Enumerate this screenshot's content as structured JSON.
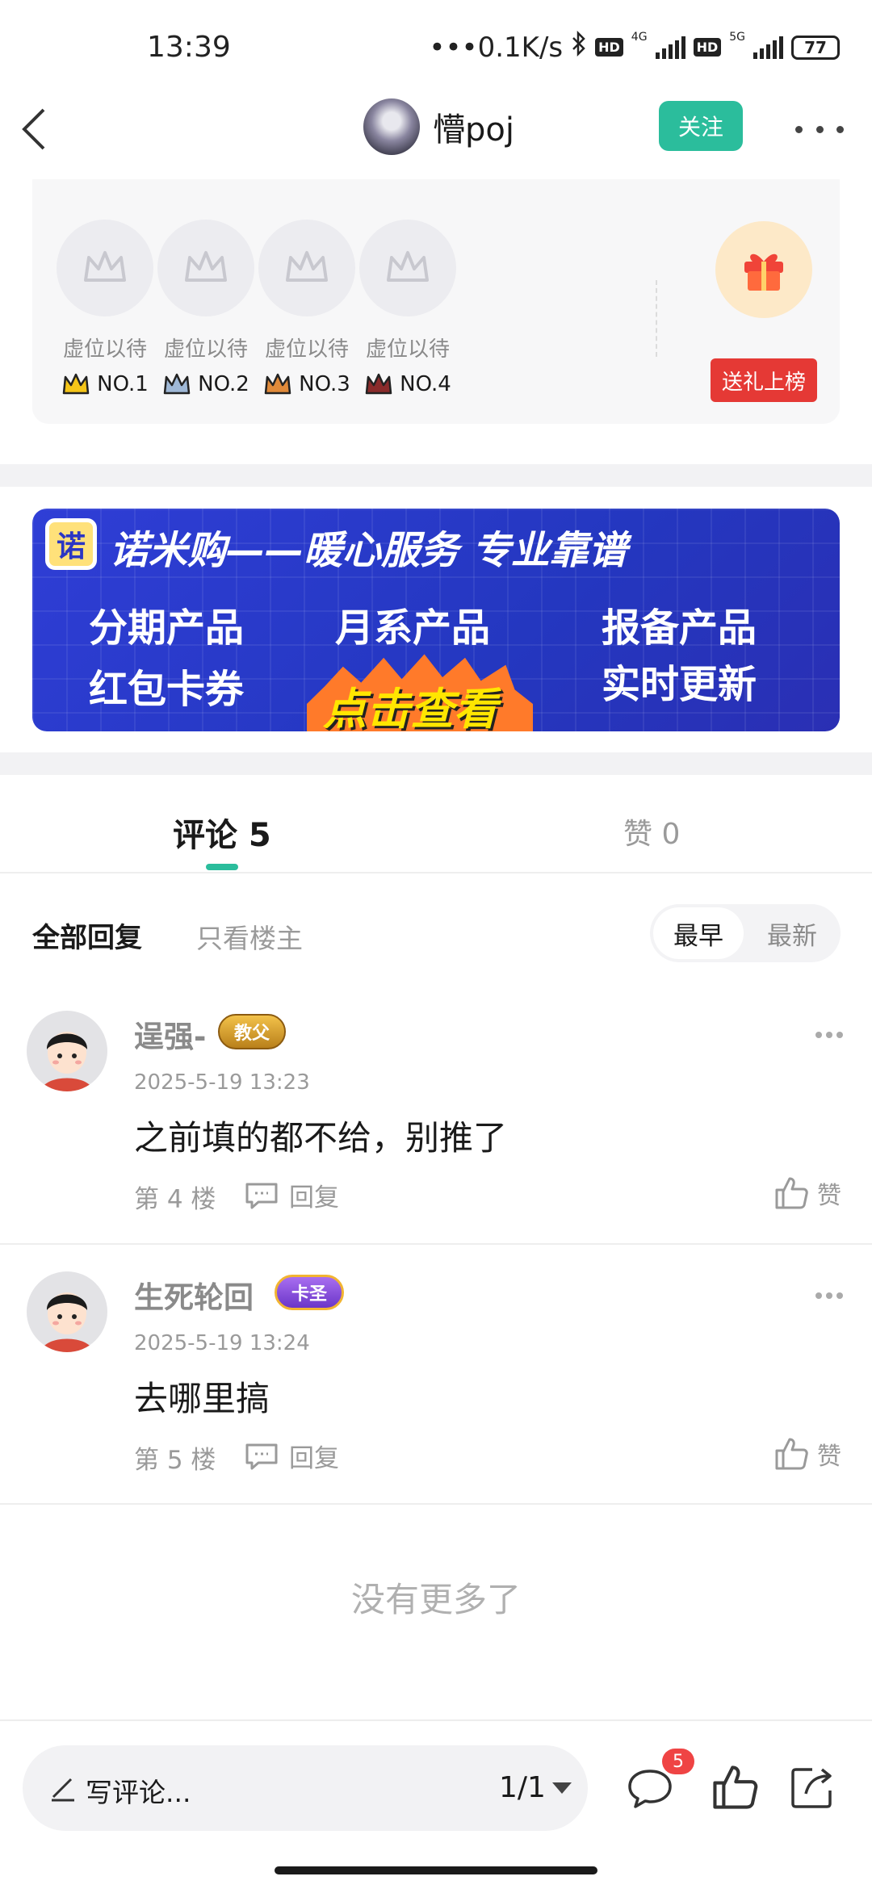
{
  "status_bar": {
    "time": "13:39",
    "speed": "•••0.1K/s",
    "hd": "HD",
    "net1": "4G",
    "net2": "5G",
    "battery": "77"
  },
  "nav": {
    "username": "懵poj",
    "follow_label": "关注"
  },
  "rank": {
    "slots": [
      {
        "label": "虚位以待",
        "rank": "NO.1",
        "crown_color": "#f5c518"
      },
      {
        "label": "虚位以待",
        "rank": "NO.2",
        "crown_color": "#9fb8d6"
      },
      {
        "label": "虚位以待",
        "rank": "NO.3",
        "crown_color": "#e08a3a"
      },
      {
        "label": "虚位以待",
        "rank": "NO.4",
        "crown_color": "#8a2b2b"
      }
    ],
    "send_gift_label": "送礼上榜"
  },
  "banner": {
    "logo": "诺",
    "headline": "诺米购——暖心服务 专业靠谱",
    "items": [
      "分期产品",
      "月系产品",
      "报备产品",
      "红包卡券",
      "实时更新"
    ],
    "cta": "点击查看"
  },
  "tabs": {
    "comments_label": "评论 5",
    "likes_label": "赞 0"
  },
  "filters": {
    "all_label": "全部回复",
    "op_label": "只看楼主",
    "sort_earliest": "最早",
    "sort_latest": "最新"
  },
  "comments": [
    {
      "name": "逞强-",
      "badge": "教父",
      "time": "2025-5-19 13:23",
      "text": "之前填的都不给，别推了",
      "floor": "第 4 楼",
      "reply_label": "回复",
      "like_label": "赞"
    },
    {
      "name": "生死轮回",
      "badge": "卡圣",
      "time": "2025-5-19 13:24",
      "text": "去哪里搞",
      "floor": "第 5 楼",
      "reply_label": "回复",
      "like_label": "赞"
    }
  ],
  "no_more": "没有更多了",
  "bottom_bar": {
    "comment_placeholder": "写评论...",
    "page_indicator": "1/1",
    "comments_badge": "5"
  },
  "colors": {
    "accent": "#2bbd9c",
    "gift_button": "#e53935",
    "badge_red": "#ef4444"
  }
}
